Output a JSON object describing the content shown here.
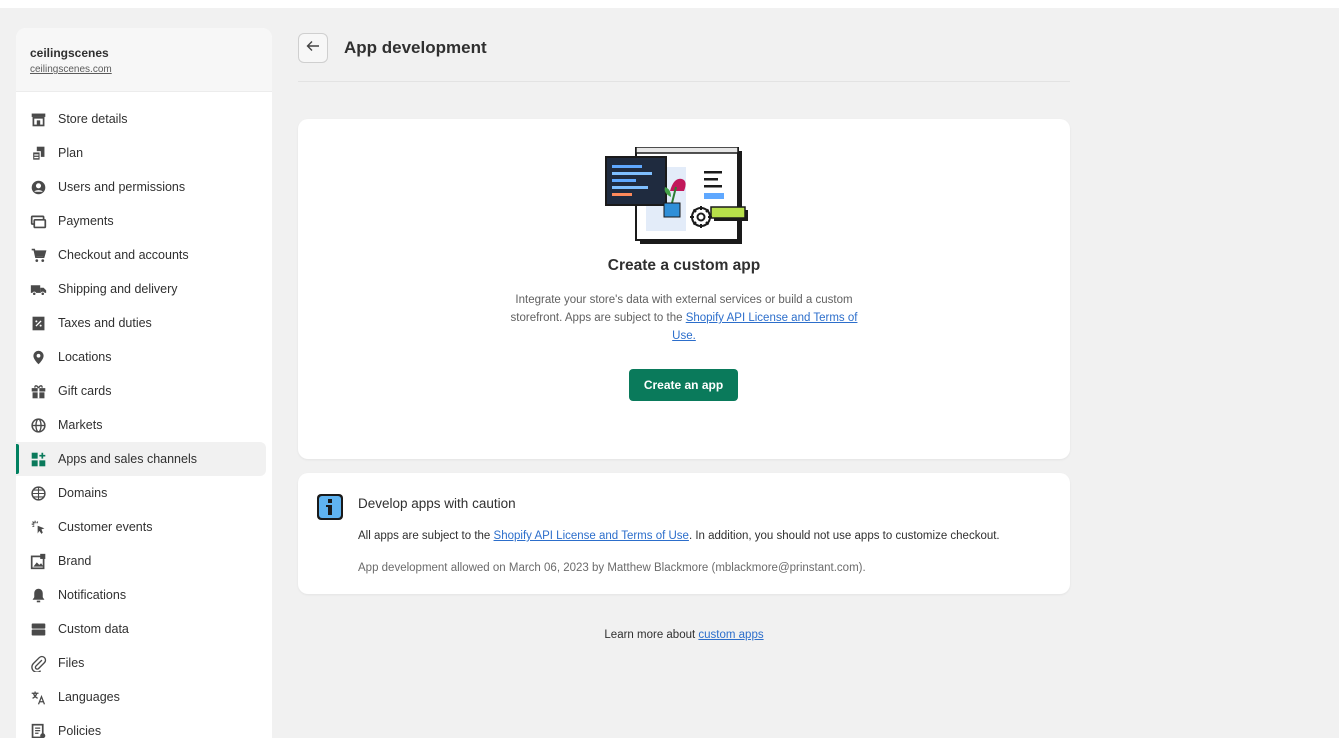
{
  "store": {
    "name": "ceilingscenes",
    "url": "ceilingscenes.com"
  },
  "sidebar": {
    "items": [
      {
        "label": "Store details",
        "icon": "store-icon"
      },
      {
        "label": "Plan",
        "icon": "plan-icon"
      },
      {
        "label": "Users and permissions",
        "icon": "user-icon"
      },
      {
        "label": "Payments",
        "icon": "payments-icon"
      },
      {
        "label": "Checkout and accounts",
        "icon": "cart-icon"
      },
      {
        "label": "Shipping and delivery",
        "icon": "truck-icon"
      },
      {
        "label": "Taxes and duties",
        "icon": "tax-icon"
      },
      {
        "label": "Locations",
        "icon": "location-pin-icon"
      },
      {
        "label": "Gift cards",
        "icon": "gift-icon"
      },
      {
        "label": "Markets",
        "icon": "globe-icon"
      },
      {
        "label": "Apps and sales channels",
        "icon": "apps-icon",
        "active": true
      },
      {
        "label": "Domains",
        "icon": "domains-globe-icon"
      },
      {
        "label": "Customer events",
        "icon": "cursor-click-icon"
      },
      {
        "label": "Brand",
        "icon": "brand-icon"
      },
      {
        "label": "Notifications",
        "icon": "bell-icon"
      },
      {
        "label": "Custom data",
        "icon": "database-icon"
      },
      {
        "label": "Files",
        "icon": "paperclip-icon"
      },
      {
        "label": "Languages",
        "icon": "translate-icon"
      },
      {
        "label": "Policies",
        "icon": "policy-icon"
      }
    ]
  },
  "header": {
    "title": "App development",
    "back_icon": "arrow-left-icon"
  },
  "empty_state": {
    "title": "Create a custom app",
    "body_prefix": "Integrate your store's data with external services or build a custom storefront. Apps are subject to the ",
    "body_link": "Shopify API License and Terms of Use.",
    "button": "Create an app"
  },
  "caution": {
    "title": "Develop apps with caution",
    "body_prefix": "All apps are subject to the ",
    "body_link": "Shopify API License and Terms of Use",
    "body_suffix": ". In addition, you should not use apps to customize checkout.",
    "meta": "App development allowed on March 06, 2023 by Matthew Blackmore (mblackmore@prinstant.com)."
  },
  "footer": {
    "prefix": "Learn more about ",
    "link": "custom apps"
  },
  "colors": {
    "accent": "#008060",
    "button": "#0a7a5b",
    "link": "#2c6ecb",
    "background": "#f1f1f1"
  }
}
